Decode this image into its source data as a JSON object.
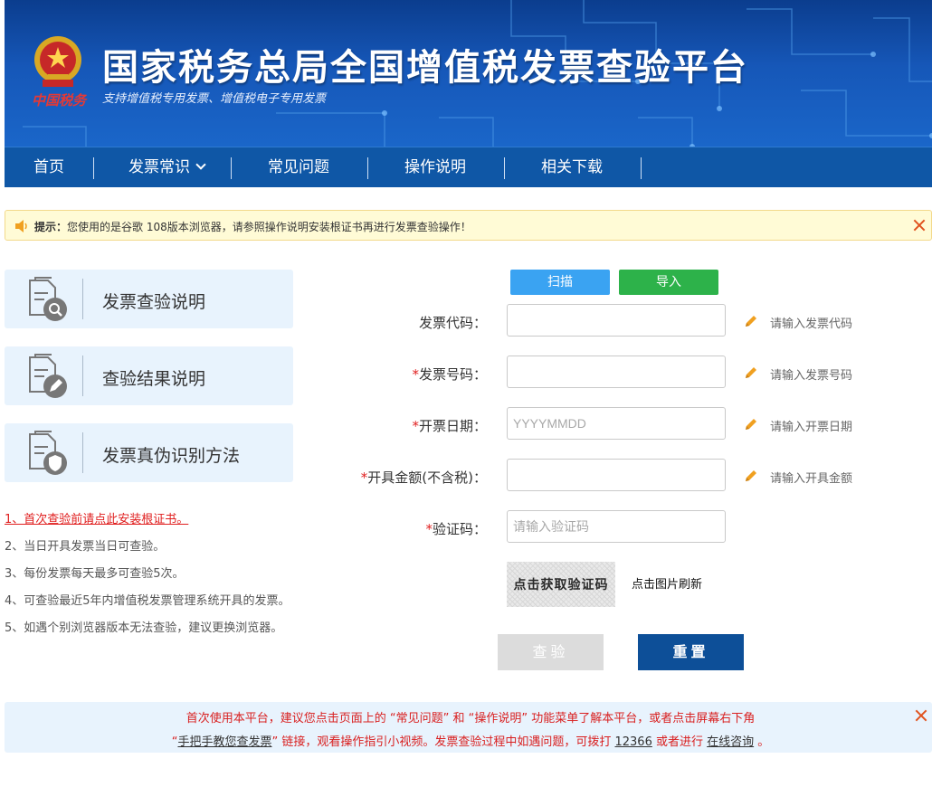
{
  "header": {
    "title": "国家税务总局全国增值税发票查验平台",
    "subtitle": "支持增值税专用发票、增值税电子专用发票",
    "brand_script": "中国税务"
  },
  "nav": {
    "items": [
      {
        "label": "首页"
      },
      {
        "label": "发票常识"
      },
      {
        "label": "常见问题"
      },
      {
        "label": "操作说明"
      },
      {
        "label": "相关下载"
      }
    ]
  },
  "notice": {
    "prefix": "提示：",
    "text": "您使用的是谷歌 108版本浏览器，请参照操作说明安装根证书再进行发票查验操作！"
  },
  "cards": [
    {
      "label": "发票查验说明",
      "icon": "document-search-icon"
    },
    {
      "label": "查验结果说明",
      "icon": "document-edit-icon"
    },
    {
      "label": "发票真伪识别方法",
      "icon": "document-shield-icon"
    }
  ],
  "tips": [
    "1、首次查验前请点此安装根证书。",
    "2、当日开具发票当日可查验。",
    "3、每份发票每天最多可查验5次。",
    "4、可查验最近5年内增值税发票管理系统开具的发票。",
    "5、如遇个别浏览器版本无法查验，建议更换浏览器。"
  ],
  "form": {
    "scan_label": "扫描",
    "import_label": "导入",
    "fields": [
      {
        "label": "发票代码：",
        "required": "",
        "placeholder": "",
        "hint": "请输入发票代码"
      },
      {
        "label": "发票号码：",
        "required": "*",
        "placeholder": "",
        "hint": "请输入发票号码"
      },
      {
        "label": "开票日期：",
        "required": "*",
        "placeholder": "YYYYMMDD",
        "hint": "请输入开票日期"
      },
      {
        "label": "开具金额(不含税)：",
        "required": "*",
        "placeholder": "",
        "hint": "请输入开具金额"
      },
      {
        "label": "验证码：",
        "required": "*",
        "placeholder": "请输入验证码",
        "hint": ""
      }
    ],
    "captcha_text": "点击获取验证码",
    "captcha_refresh": "点击图片刷新",
    "query_label": "查验",
    "reset_label": "重置"
  },
  "footer_notice": {
    "line1": "首次使用本平台，建议您点击页面上的 “常见问题” 和 “操作说明” 功能菜单了解本平台，或者点击屏幕右下角",
    "line2_a": "“",
    "line2_link1": "手把手教您查发票",
    "line2_b": "” 链接，观看操作指引小视频。发票查验过程中如遇问题，可拨打 ",
    "line2_link2": "12366",
    "line2_c": " 或者进行 ",
    "line2_link3": "在线咨询",
    "line2_d": " 。"
  },
  "colors": {
    "nav_bg": "#0f57a6",
    "scan_btn": "#3aa3f2",
    "import_btn": "#2db24a",
    "reset_btn": "#0d4f98",
    "alert_red": "#d92020"
  }
}
